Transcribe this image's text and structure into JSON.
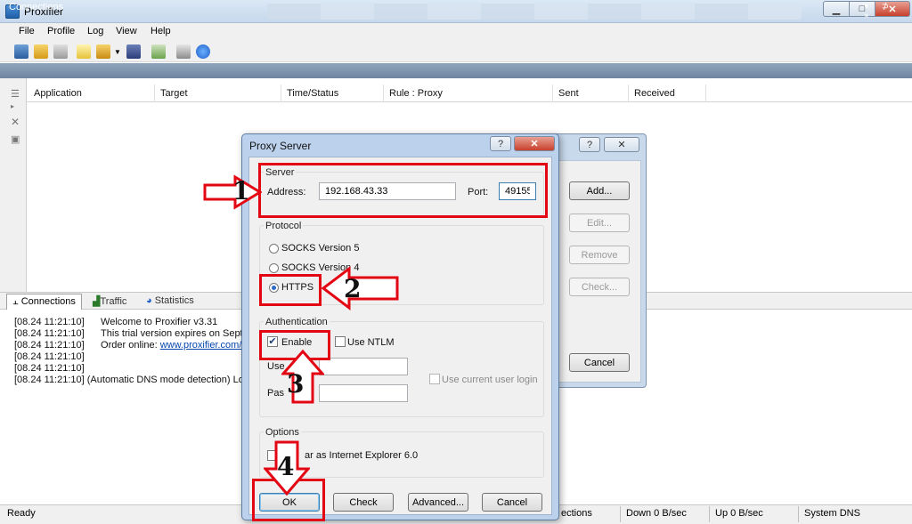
{
  "window": {
    "title": "Proxifier",
    "min": "▁",
    "max": "□",
    "close": "✕"
  },
  "menu": [
    "File",
    "Profile",
    "Log",
    "View",
    "Help"
  ],
  "connections_panel": {
    "header": "Connections",
    "controls": "▾ ⊅ ×",
    "columns": [
      "Application",
      "Target",
      "Time/Status",
      "Rule : Proxy",
      "Sent",
      "Received"
    ]
  },
  "tabs": [
    "Connections",
    "Traffic",
    "Statistics"
  ],
  "log": [
    {
      "time": "[08.24 11:21:10]",
      "text": "Welcome to Proxifier v3.31"
    },
    {
      "time": "[08.24 11:21:10]",
      "text": "This trial version expires on September"
    },
    {
      "time": "[08.24 11:21:10]",
      "text": "Order online: ",
      "link": "www.proxifier.com/orde"
    },
    {
      "time": "[08.24 11:21:10]",
      "text": ""
    },
    {
      "time": "[08.24 11:21:10]",
      "text": "(Automatic DNS mode detection) Local"
    }
  ],
  "status": {
    "ready": "Ready",
    "connections": "ections",
    "down": "Down 0 B/sec",
    "up": "Up 0 B/sec",
    "dns": "System DNS"
  },
  "back_dialog": {
    "help": "?",
    "close": "✕",
    "add": "Add...",
    "edit": "Edit...",
    "remove": "Remove",
    "check": "Check...",
    "cancel": "Cancel"
  },
  "proxy_dialog": {
    "title": "Proxy Server",
    "help": "?",
    "close": "✕",
    "server": {
      "group": "Server",
      "address_label": "Address:",
      "address": "192.168.43.33",
      "port_label": "Port:",
      "port": "49155"
    },
    "protocol": {
      "group": "Protocol",
      "options": [
        "SOCKS Version 5",
        "SOCKS Version 4",
        "HTTPS"
      ],
      "selected": "HTTPS"
    },
    "auth": {
      "group": "Authentication",
      "enable": "Enable",
      "enable_checked": true,
      "use_ntlm": "Use NTLM",
      "user_label": "Use",
      "pass_label": "Pas",
      "use_current": "Use current user login"
    },
    "options": {
      "group": "Options",
      "ie_label": "ar as Internet Explorer 6.0"
    },
    "buttons": {
      "ok": "OK",
      "check": "Check",
      "advanced": "Advanced...",
      "cancel": "Cancel"
    }
  },
  "annotations": [
    "1",
    "2",
    "3",
    "4"
  ],
  "colors": {
    "annotation_red": "#e30613",
    "titlebar": "#dbe8f5",
    "dialog_frame": "#bcd2ec"
  }
}
